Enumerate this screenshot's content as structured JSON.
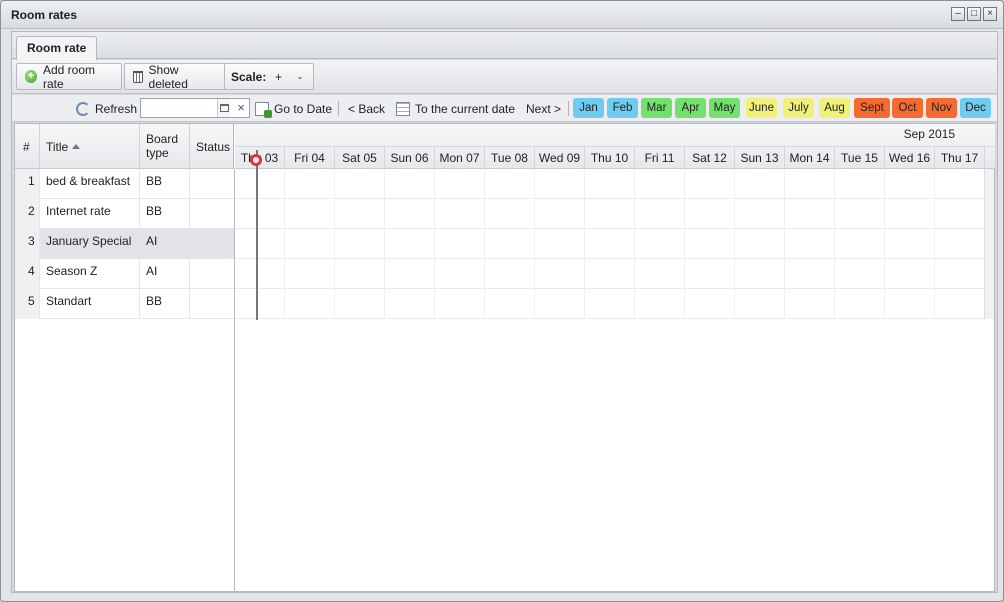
{
  "window": {
    "title": "Room rates"
  },
  "tabs": [
    {
      "label": "Room rate"
    }
  ],
  "toolbar": {
    "add_label": "Add room rate",
    "show_deleted_label": "Show deleted",
    "scale_label": "Scale:",
    "scale_plus": "+",
    "scale_minus": "-"
  },
  "nav": {
    "refresh_label": "Refresh",
    "date_value": "",
    "clear_symbol": "×",
    "goto_label": "Go to Date",
    "back_label": "< Back",
    "current_label": "To the current date",
    "next_label": "Next >"
  },
  "months": [
    {
      "label": "Jan",
      "color": "#6fcbf0"
    },
    {
      "label": "Feb",
      "color": "#6fcbf0"
    },
    {
      "label": "Mar",
      "color": "#74e06e"
    },
    {
      "label": "Apr",
      "color": "#74e06e"
    },
    {
      "label": "May",
      "color": "#74e06e"
    },
    {
      "label": "June",
      "color": "#f0f07a"
    },
    {
      "label": "July",
      "color": "#f0f07a"
    },
    {
      "label": "Aug",
      "color": "#f0f07a"
    },
    {
      "label": "Sept",
      "color": "#f56a2e"
    },
    {
      "label": "Oct",
      "color": "#f56a2e"
    },
    {
      "label": "Nov",
      "color": "#f56a2e"
    },
    {
      "label": "Dec",
      "color": "#6fcbf0"
    }
  ],
  "table": {
    "headers": {
      "num": "#",
      "title": "Title",
      "board": "Board type",
      "status": "Status"
    },
    "rows": [
      {
        "num": "1",
        "title": "bed & breakfast",
        "board": "BB",
        "status": ""
      },
      {
        "num": "2",
        "title": "Internet rate",
        "board": "BB",
        "status": ""
      },
      {
        "num": "3",
        "title": "January Special",
        "board": "AI",
        "status": ""
      },
      {
        "num": "4",
        "title": "Season Z",
        "board": "AI",
        "status": ""
      },
      {
        "num": "5",
        "title": "Standart",
        "board": "BB",
        "status": ""
      }
    ]
  },
  "timeline": {
    "month_label": "Sep 2015",
    "days": [
      "Thu 03",
      "Fri 04",
      "Sat 05",
      "Sun 06",
      "Mon 07",
      "Tue 08",
      "Wed 09",
      "Thu 10",
      "Fri 11",
      "Sat 12",
      "Sun 13",
      "Mon 14",
      "Tue 15",
      "Wed 16",
      "Thu 17"
    ]
  }
}
